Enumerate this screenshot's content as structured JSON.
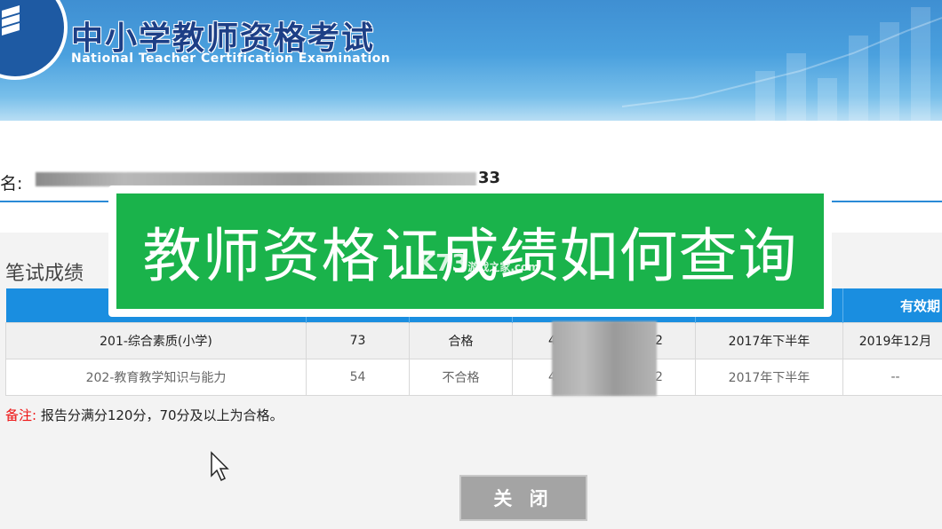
{
  "header": {
    "title_cn": "中小学教师资格考试",
    "title_en": "National Teacher Certification Examination",
    "logo_icon": "book-stack-icon"
  },
  "candidate": {
    "name_label": "名:",
    "name_tail": "33"
  },
  "section": {
    "title": "笔试成绩"
  },
  "table": {
    "header_visible": "有效期",
    "rows": [
      {
        "subject": "201-综合素质(小学)",
        "score": "73",
        "result": "合格",
        "id_start": "4",
        "id_end": "2",
        "term": "2017年下半年",
        "valid": "2019年12月"
      },
      {
        "subject": "202-教育教学知识与能力",
        "score": "54",
        "result": "不合格",
        "id_start": "4",
        "id_end": "2",
        "term": "2017年下半年",
        "valid": "--"
      }
    ]
  },
  "remark": {
    "prefix": "备注:",
    "text": "报告分满分120分，70分及以上为合格。"
  },
  "close_button": "关 闭",
  "overlay": {
    "caption": "教师资格证成绩如何查询",
    "watermark_main": "K73",
    "watermark_sub": "游戏之家",
    "watermark_domain": ".com"
  },
  "colors": {
    "brand_blue": "#1a8ee0",
    "caption_green": "#1ab34b",
    "fail_red": "#e11111"
  }
}
